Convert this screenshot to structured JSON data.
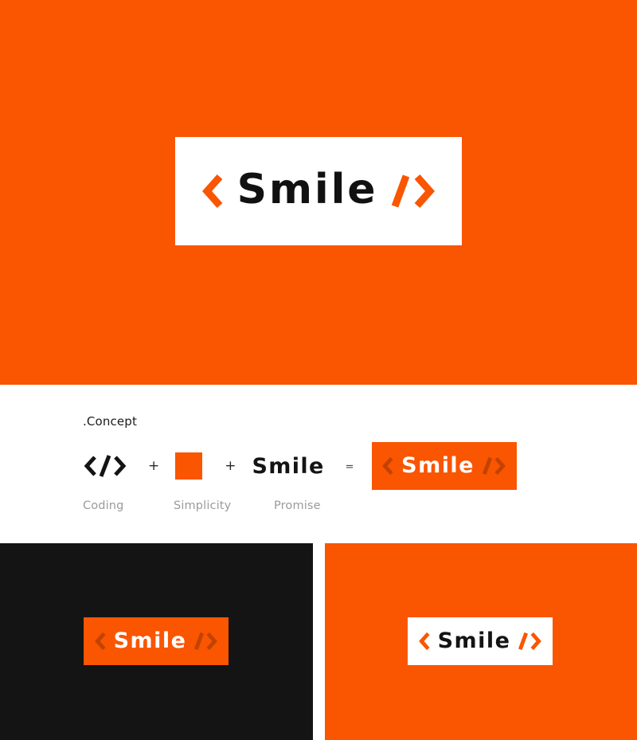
{
  "brand": {
    "name": "Smile",
    "chevron_left": "<",
    "slash": "/",
    "chevron_right": ">",
    "code_glyph": "</>",
    "colors": {
      "orange": "#FA5500",
      "orange_dark": "#C24200",
      "black": "#141414",
      "white": "#FFFFFF",
      "gray_label": "#9B9B9B"
    }
  },
  "hero": {
    "background_color": "#FA5500",
    "logo": {
      "word": "Smile",
      "left_mark": "<",
      "right_mark": "/>"
    }
  },
  "concept": {
    "title": ".Concept",
    "operators": {
      "plus": "+",
      "equals": "="
    },
    "items": [
      {
        "symbol": "</>",
        "label": "Coding"
      },
      {
        "symbol": "",
        "label": "Simplicity"
      },
      {
        "symbol": "Smile",
        "label": "Promise"
      }
    ],
    "result": {
      "word": "Smile",
      "left_mark": "<",
      "right_mark": "/>"
    }
  },
  "variants": [
    {
      "name": "dark-panel",
      "background_color": "#141414",
      "badge_background": "#FA5500",
      "word": "Smile",
      "word_color": "#FFFFFF",
      "mark_color": "#C24200"
    },
    {
      "name": "orange-panel",
      "background_color": "#FA5500",
      "badge_background": "#FFFFFF",
      "word": "Smile",
      "word_color": "#141414",
      "mark_color": "#FA5500"
    }
  ]
}
